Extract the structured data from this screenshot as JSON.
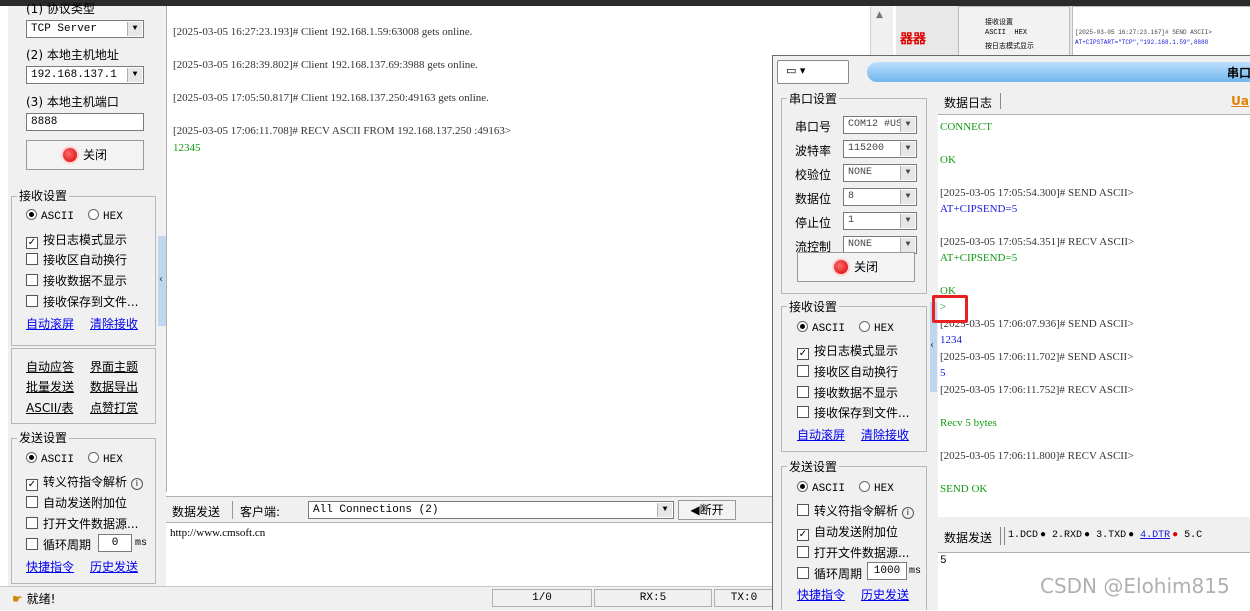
{
  "left": {
    "protocol_section": "(1) 协议类型",
    "protocol_value": "TCP Server",
    "host_addr_label": "(2) 本地主机地址",
    "host_addr_value": "192.168.137.1",
    "host_port_label": "(3) 本地主机端口",
    "host_port_value": "8888",
    "close_button": "关闭",
    "recv_title": "接收设置",
    "ascii": "ASCII",
    "hex": "HEX",
    "recv_opts": [
      "按日志模式显示",
      "接收区自动换行",
      "接收数据不显示",
      "接收保存到文件..."
    ],
    "auto_scroll": "自动滚屏",
    "clear_recv": "清除接收",
    "tools": [
      "自动应答",
      "界面主题",
      "批量发送",
      "数据导出",
      "ASCII/表",
      "点赞打赏"
    ],
    "send_title": "发送设置",
    "send_opts": [
      "转义符指令解析",
      "自动发送附加位",
      "打开文件数据源...",
      "循环周期"
    ],
    "cycle_value": "0",
    "cycle_unit": "ms",
    "quick_cmd": "快捷指令",
    "history": "历史发送"
  },
  "log": {
    "lines": [
      "[2025-03-05 16:27:23.193]# Client 192.168.1.59:63008 gets online.",
      "[2025-03-05 16:28:39.802]# Client 192.168.137.69:3988 gets online.",
      "[2025-03-05 17:05:50.817]# Client 192.168.137.250:49163 gets online.",
      "[2025-03-05 17:06:11.708]# RECV ASCII FROM 192.168.137.250 :49163>"
    ],
    "data": "12345"
  },
  "send_area": {
    "tab": "数据发送",
    "client_label": "客户端:",
    "connections": "All Connections (2)",
    "disconnect": "断开",
    "text": "http://www.cmsoft.cn"
  },
  "status": {
    "ready": "就绪!",
    "page": "1/0",
    "rx": "RX:5",
    "tx": "TX:0"
  },
  "bg_fragment": {
    "red_text": "器器",
    "recv_title": "接收设置",
    "ascii": "ASCII",
    "hex": "HEX",
    "opt": "按日志模式显示",
    "log1": "[2025-03-05 16:27:23.167]# SEND ASCII>",
    "log2": "AT+CIPSTART=\"TCP\",\"192.168.1.59\",8888"
  },
  "right": {
    "title_fragment": "串口",
    "serial_title": "串口设置",
    "fields": [
      {
        "label": "串口号",
        "value": "COM12 #US"
      },
      {
        "label": "波特率",
        "value": "115200"
      },
      {
        "label": "校验位",
        "value": "NONE"
      },
      {
        "label": "数据位",
        "value": "8"
      },
      {
        "label": "停止位",
        "value": "1"
      },
      {
        "label": "流控制",
        "value": "NONE"
      }
    ],
    "close_button": "关闭",
    "recv_title": "接收设置",
    "ascii": "ASCII",
    "hex": "HEX",
    "recv_opts": [
      "按日志模式显示",
      "接收区自动换行",
      "接收数据不显示",
      "接收保存到文件..."
    ],
    "auto_scroll": "自动滚屏",
    "clear_recv": "清除接收",
    "send_title": "发送设置",
    "send_opts": [
      "转义符指令解析",
      "自动发送附加位",
      "打开文件数据源...",
      "循环周期"
    ],
    "cycle_value": "1000",
    "cycle_unit": "ms",
    "quick_cmd": "快捷指令",
    "history": "历史发送",
    "log_tab": "数据日志",
    "log_tab_right": "Ua",
    "log_lines": [
      {
        "text": "CONNECT",
        "cls": "green"
      },
      {
        "text": "OK",
        "cls": "green"
      },
      {
        "text": "[2025-03-05 17:05:54.300]# SEND ASCII>",
        "cls": ""
      },
      {
        "text": "AT+CIPSEND=5",
        "cls": "blue"
      },
      {
        "text": "[2025-03-05 17:05:54.351]# RECV ASCII>",
        "cls": ""
      },
      {
        "text": "AT+CIPSEND=5",
        "cls": "green"
      },
      {
        "text": "OK",
        "cls": "green"
      },
      {
        "text": ">",
        "cls": "green"
      },
      {
        "text": "[2025-03-05 17:06:07.936]# SEND ASCII>",
        "cls": ""
      },
      {
        "text": "1234",
        "cls": "blue"
      },
      {
        "text": "[2025-03-05 17:06:11.702]# SEND ASCII>",
        "cls": ""
      },
      {
        "text": "5",
        "cls": "blue"
      },
      {
        "text": "[2025-03-05 17:06:11.752]# RECV ASCII>",
        "cls": ""
      },
      {
        "text": "Recv 5 bytes",
        "cls": "green"
      },
      {
        "text": "[2025-03-05 17:06:11.800]# RECV ASCII>",
        "cls": ""
      },
      {
        "text": "SEND OK",
        "cls": "green"
      }
    ],
    "send_tab": "数据发送",
    "pins": [
      {
        "label": "1.DCD",
        "mark": "●",
        "color": "#000000"
      },
      {
        "label": "2.RXD",
        "mark": "●",
        "color": "#000000"
      },
      {
        "label": "3.TXD",
        "mark": "●",
        "color": "#000000"
      },
      {
        "label": "4.DTR",
        "mark": "●",
        "color": "#e00000"
      },
      {
        "label": "5.C",
        "mark": "",
        "color": "#000000"
      }
    ],
    "send_text": "5"
  },
  "watermark": "CSDN @Elohim815"
}
